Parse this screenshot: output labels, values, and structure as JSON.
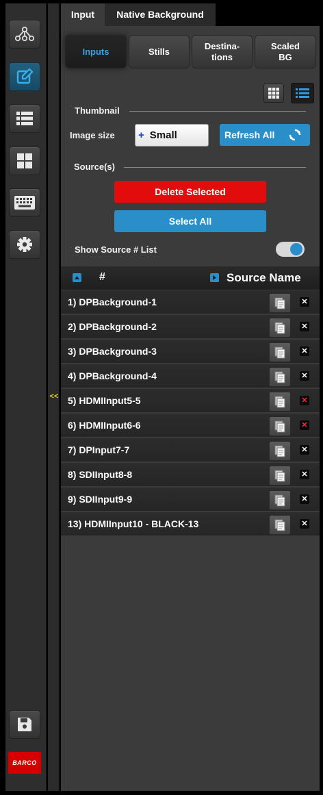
{
  "rail": {
    "icons": [
      "hierarchy-icon",
      "edit-icon",
      "list-icon",
      "grid-icon",
      "keyboard-icon",
      "gear-icon"
    ],
    "save_icon": "save-icon",
    "brand": "BARCO",
    "collapse_label": "<<"
  },
  "panel": {
    "top_tabs": [
      "Input",
      "Native Background"
    ],
    "sub_tabs": [
      "Inputs",
      "Stills",
      "Destina-\ntions",
      "Scaled\nBG"
    ],
    "thumbnail_label": "Thumbnail",
    "image_size_label": "Image size",
    "image_size_value": "Small",
    "image_size_plus": "+",
    "refresh_all": "Refresh All",
    "sources_label": "Source(s)",
    "delete_selected": "Delete Selected",
    "select_all": "Select All",
    "show_source_list": "Show Source # List",
    "show_source_list_on": true
  },
  "table": {
    "col_number": "#",
    "col_name": "Source Name",
    "rows": [
      {
        "label": "1)  DPBackground-1",
        "x_red": false
      },
      {
        "label": "2)  DPBackground-2",
        "x_red": false
      },
      {
        "label": "3)  DPBackground-3",
        "x_red": false
      },
      {
        "label": "4)  DPBackground-4",
        "x_red": false
      },
      {
        "label": "5)  HDMIInput5-5",
        "x_red": true
      },
      {
        "label": "6)  HDMIInput6-6",
        "x_red": true
      },
      {
        "label": "7)  DPInput7-7",
        "x_red": false
      },
      {
        "label": "8)  SDIInput8-8",
        "x_red": false
      },
      {
        "label": "9)  SDIInput9-9",
        "x_red": false
      },
      {
        "label": "13)  HDMIInput10 - BLACK-13",
        "x_red": false
      }
    ]
  },
  "colors": {
    "accent_blue": "#2a8fc8",
    "delete_red": "#e20c0c",
    "active_tab_text": "#3ba3dc"
  }
}
